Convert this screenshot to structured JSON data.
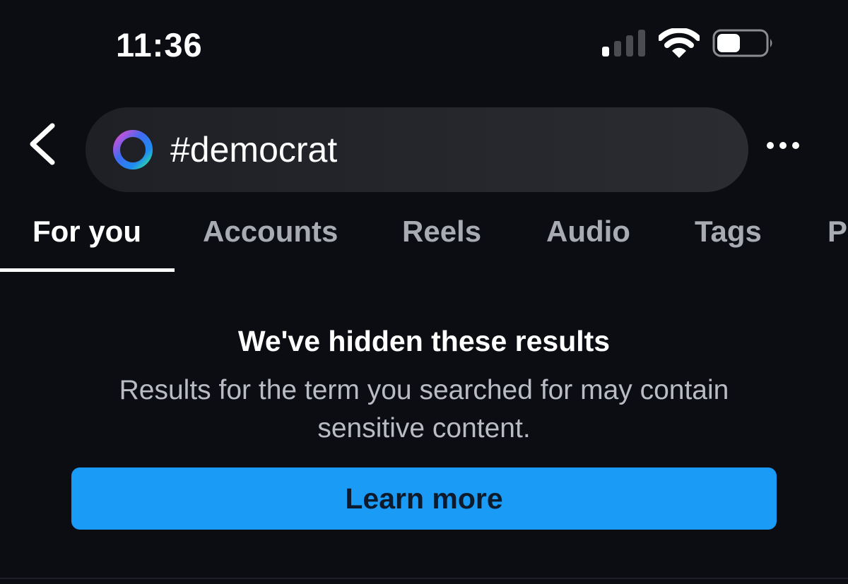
{
  "status_bar": {
    "time": "11:36",
    "signal_icon": "cellular-signal-icon",
    "wifi_icon": "wifi-icon",
    "battery_icon": "battery-icon"
  },
  "header": {
    "back_icon": "chevron-left-icon",
    "search": {
      "value": "#democrat",
      "icon": "meta-ai-ring-icon"
    },
    "more_icon": "more-horizontal-icon"
  },
  "tabs": [
    {
      "label": "For you",
      "active": true
    },
    {
      "label": "Accounts"
    },
    {
      "label": "Reels"
    },
    {
      "label": "Audio"
    },
    {
      "label": "Tags"
    },
    {
      "label": "P"
    }
  ],
  "notice": {
    "title": "We've hidden these results",
    "description": "Results for the term you searched for may contain sensitive content.",
    "button_label": "Learn more"
  },
  "colors": {
    "background": "#0b0d12",
    "search_bg": "#26282d",
    "button": "#1a9bf5"
  }
}
